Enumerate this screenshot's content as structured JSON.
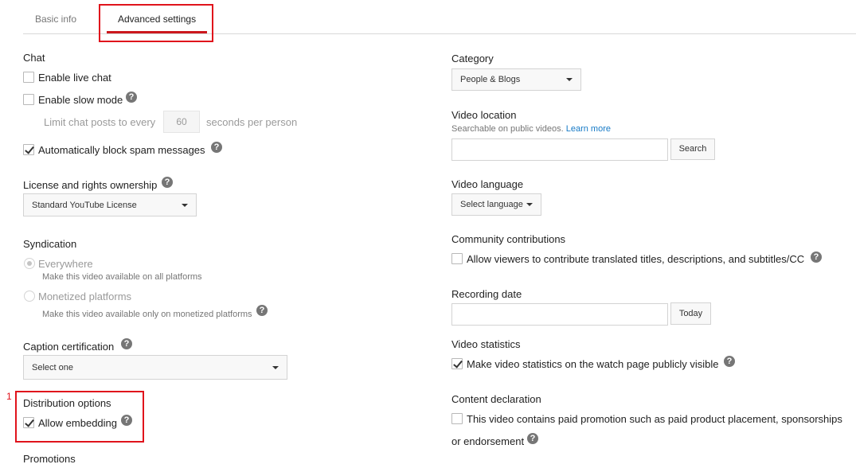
{
  "tabs": {
    "basic_info": "Basic info",
    "advanced_settings": "Advanced settings"
  },
  "annotation": {
    "number": "1"
  },
  "chat": {
    "heading": "Chat",
    "enable_live_chat": {
      "label": "Enable live chat",
      "checked": false
    },
    "enable_slow_mode": {
      "label": "Enable slow mode",
      "checked": false
    },
    "limit_prefix": "Limit chat posts to every",
    "limit_value": "60",
    "limit_suffix": "seconds per person",
    "block_spam": {
      "label": "Automatically block spam messages",
      "checked": true
    }
  },
  "license": {
    "heading": "License and rights ownership",
    "selected": "Standard YouTube License"
  },
  "syndication": {
    "heading": "Syndication",
    "everywhere": {
      "label": "Everywhere",
      "sub": "Make this video available on all platforms",
      "selected": true
    },
    "monetized": {
      "label": "Monetized platforms",
      "sub": "Make this video available only on monetized platforms",
      "selected": false
    }
  },
  "caption": {
    "heading": "Caption certification",
    "selected": "Select one"
  },
  "distribution": {
    "heading": "Distribution options",
    "allow_embedding": {
      "label": "Allow embedding",
      "checked": true
    }
  },
  "promotions": {
    "heading": "Promotions"
  },
  "category": {
    "heading": "Category",
    "selected": "People & Blogs"
  },
  "video_location": {
    "heading": "Video location",
    "sub": "Searchable on public videos.",
    "learn_more": "Learn more",
    "value": "",
    "search_button": "Search"
  },
  "video_language": {
    "heading": "Video language",
    "selected": "Select language"
  },
  "community": {
    "heading": "Community contributions",
    "label": "Allow viewers to contribute translated titles, descriptions, and subtitles/CC",
    "checked": false
  },
  "recording_date": {
    "heading": "Recording date",
    "value": "",
    "today_button": "Today"
  },
  "video_statistics": {
    "heading": "Video statistics",
    "label": "Make video statistics on the watch page publicly visible",
    "checked": true
  },
  "content_declaration": {
    "heading": "Content declaration",
    "label_line1": "This video contains paid promotion such as paid product placement, sponsorships",
    "label_line2": "or endorsement",
    "checked": false
  },
  "colors": {
    "accent_red": "#cc181e",
    "annotation_red": "#e0131c",
    "link_blue": "#167ac6"
  },
  "icons": {
    "help": "question-mark-circle-icon",
    "dropdown": "caret-down-icon",
    "check": "checkmark-icon"
  }
}
